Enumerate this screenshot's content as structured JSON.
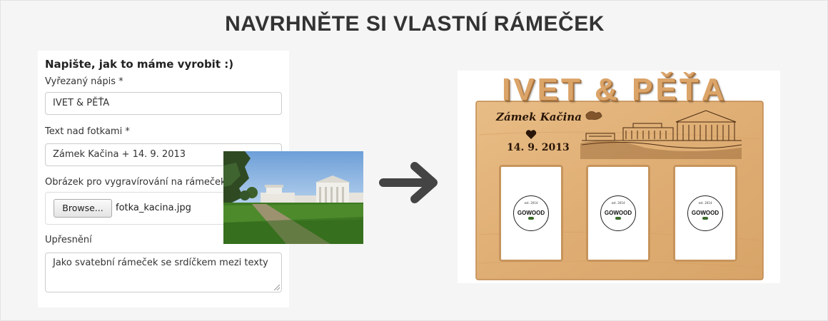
{
  "page": {
    "title": "NAVRHNĚTE SI VLASTNÍ RÁMEČEK"
  },
  "form": {
    "heading": "Napište, jak to máme vyrobit :)",
    "cut_text": {
      "label": "Vyřezaný nápis *",
      "value": "IVET & PĚŤA"
    },
    "photo_text": {
      "label": "Text nad fotkami *",
      "value": "Zámek Kačina + 14. 9. 2013"
    },
    "engraving_image": {
      "label": "Obrázek pro vygravírování na rámeček",
      "button_label": "Browse...",
      "file_name": "fotka_kacina.jpg"
    },
    "details": {
      "label": "Upřesnění",
      "value": "Jako svatební rámeček se srdíčkem mezi texty"
    }
  },
  "preview": {
    "cut_text": "IVET & PĚŤA",
    "engraved_place": "Zámek Kačina",
    "engraved_date": "14. 9. 2013",
    "logo_text": "GOWOOD",
    "logo_subtext": "est. 2014"
  },
  "colors": {
    "title": "#333333",
    "background": "#f5f5f5",
    "wood": "#e2b47d",
    "arrow": "#444444"
  },
  "icons": {
    "arrow": "arrow-right-icon",
    "heart": "heart-icon"
  }
}
